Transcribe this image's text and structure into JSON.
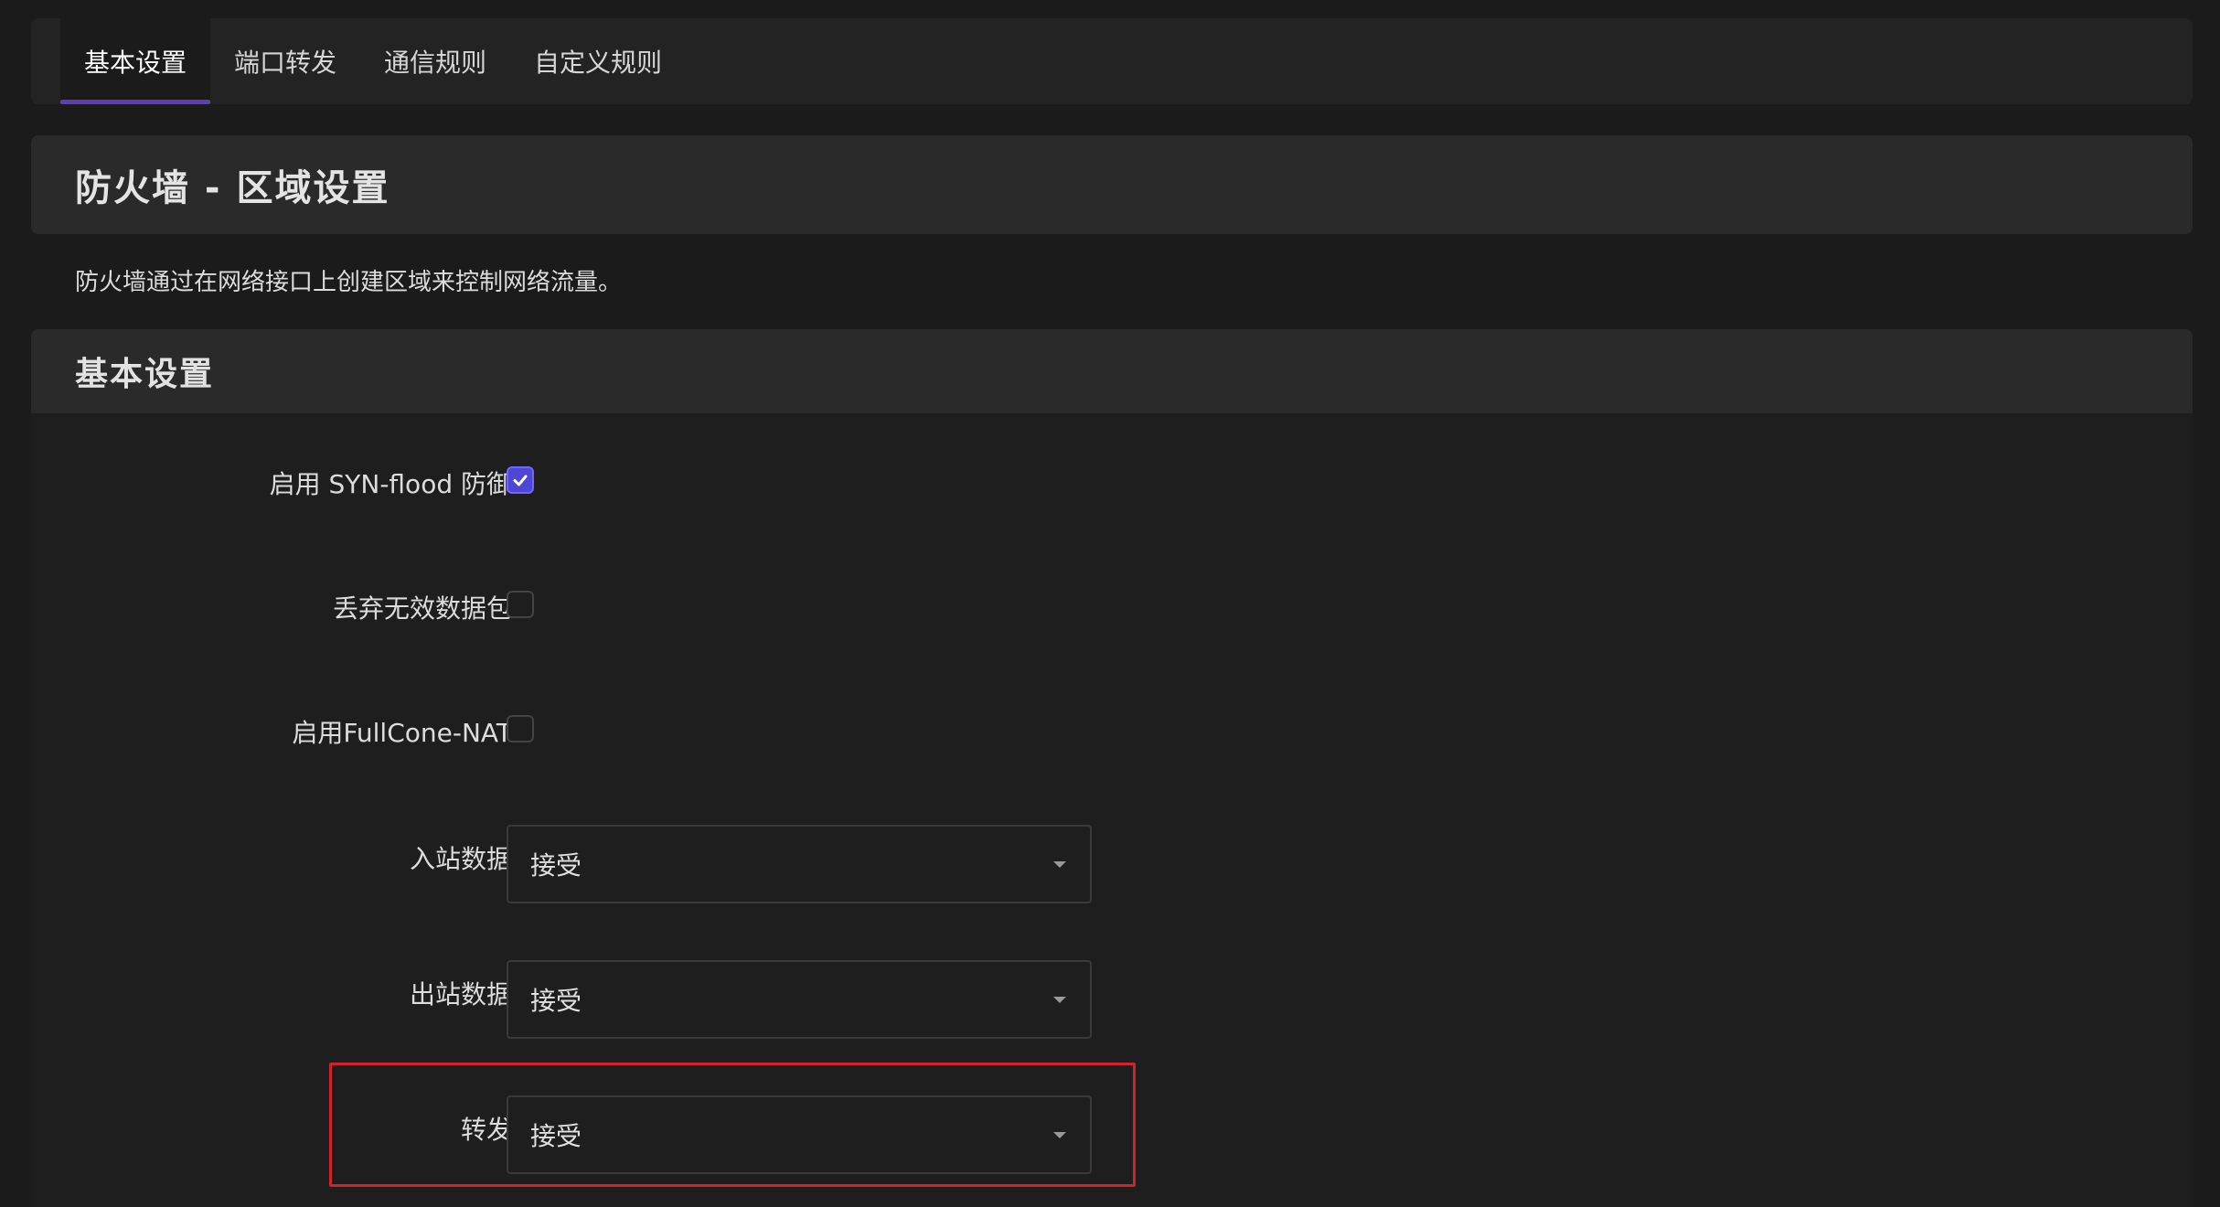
{
  "tabs": [
    {
      "label": "基本设置",
      "active": true
    },
    {
      "label": "端口转发",
      "active": false
    },
    {
      "label": "通信规则",
      "active": false
    },
    {
      "label": "自定义规则",
      "active": false
    }
  ],
  "page": {
    "title": "防火墙 - 区域设置",
    "description": "防火墙通过在网络接口上创建区域来控制网络流量。"
  },
  "section": {
    "title": "基本设置",
    "fields": {
      "syn_flood": {
        "label": "启用 SYN-flood 防御",
        "checked": true
      },
      "drop_invalid": {
        "label": "丢弃无效数据包",
        "checked": false
      },
      "fullcone_nat": {
        "label": "启用FullCone-NAT",
        "checked": false
      },
      "input": {
        "label": "入站数据",
        "value": "接受"
      },
      "output": {
        "label": "出站数据",
        "value": "接受"
      },
      "forward": {
        "label": "转发",
        "value": "接受"
      }
    }
  },
  "colors": {
    "accent": "#5a3fb6",
    "checkbox_checked": "#4f46d6",
    "highlight": "#d0232e"
  }
}
